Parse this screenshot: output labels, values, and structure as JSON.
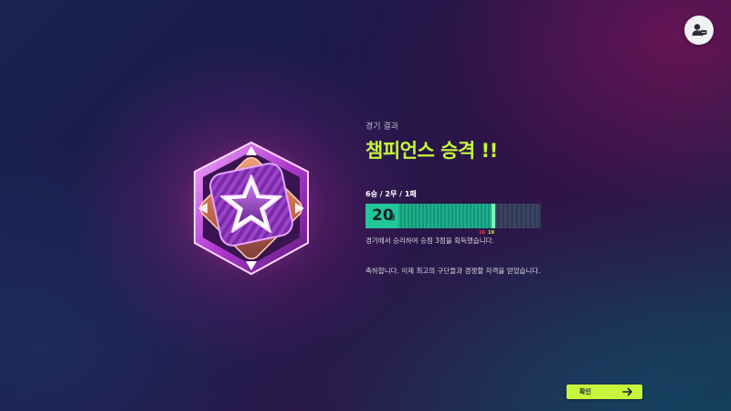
{
  "result": {
    "label": "경기 결과",
    "title": "챔피언스 승격 !!",
    "record": "6승 / 2무 / 1패"
  },
  "points": {
    "value": "20",
    "unit": "점",
    "progress_fraction": 0.74,
    "ticks": [
      {
        "label": "16",
        "color": "#ff3b3b",
        "fraction": 0.645
      },
      {
        "label": "19",
        "color": "#c6f53a",
        "fraction": 0.7
      }
    ]
  },
  "messages": {
    "earned": "경기에서 승리하여 승점 3점을 획득했습니다.",
    "congrats": "축하합니다. 이제 최고의 구단들과 경쟁할 자격을 얻었습니다."
  },
  "buttons": {
    "confirm_label": "확인",
    "confirm_icon": "arrow-right-icon",
    "profile_icon": "user-chat-icon"
  },
  "colors": {
    "accent": "#c6f53a",
    "progress": "#1fb08a",
    "badge_primary": "#8e2fb8",
    "badge_glow": "#e04fd8"
  },
  "badge": {
    "icon": "star-icon"
  }
}
